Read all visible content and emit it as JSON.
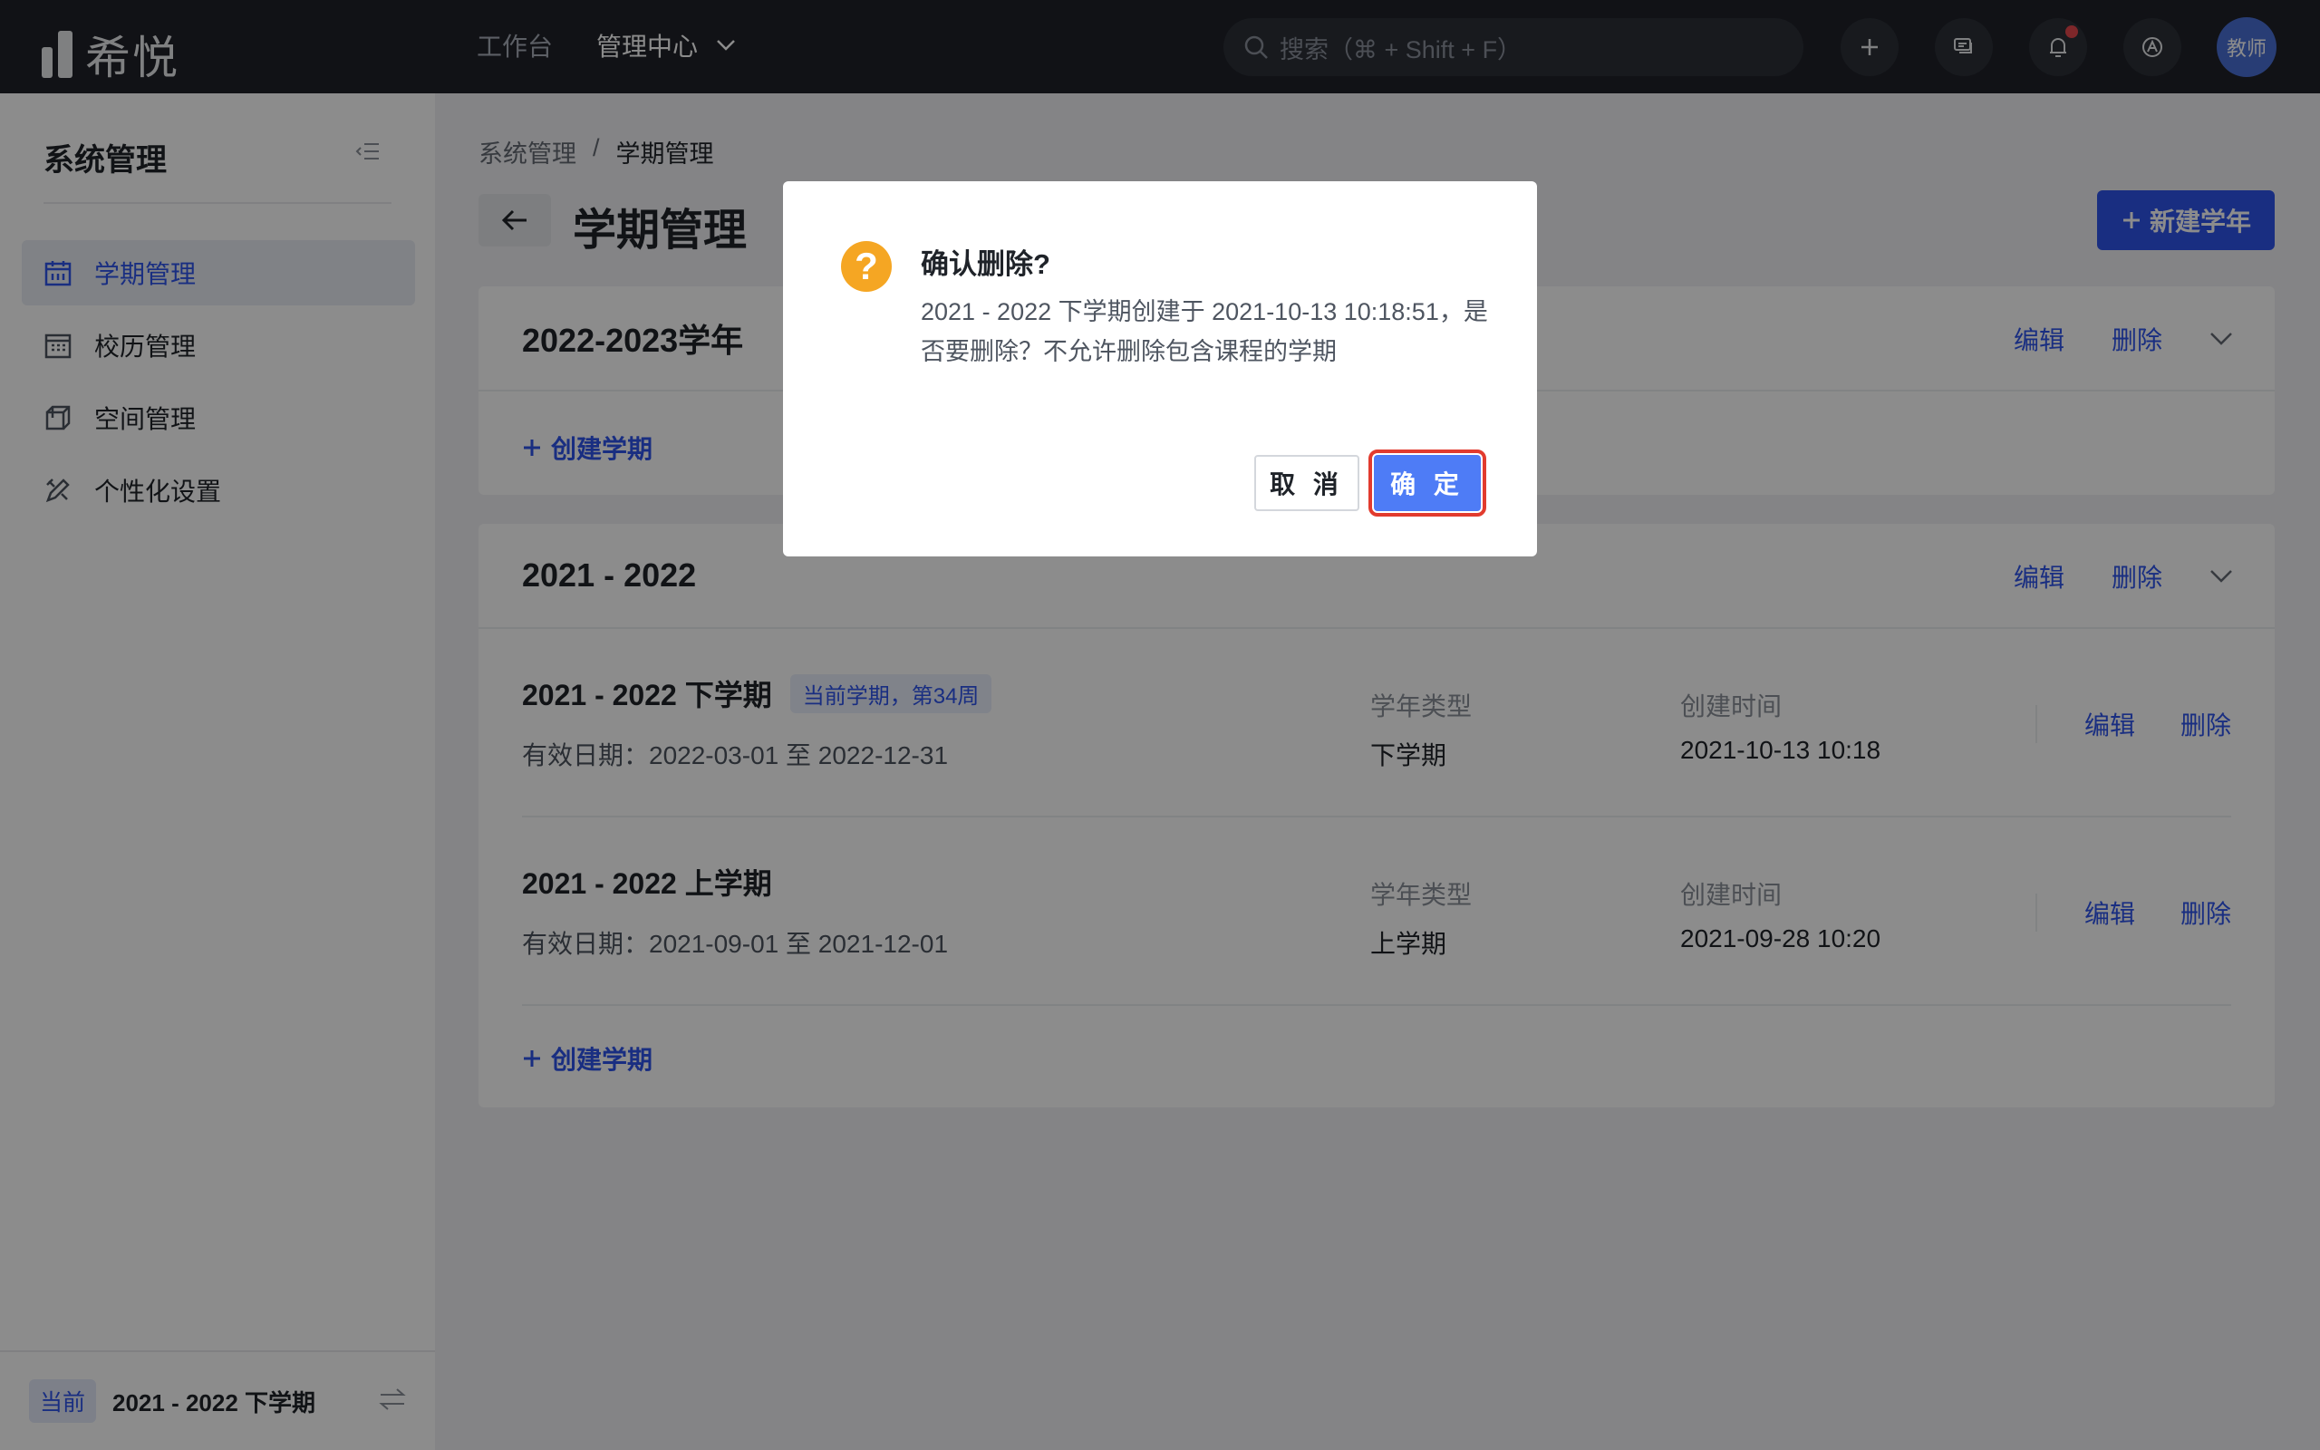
{
  "topbar": {
    "logo_text": "希悦",
    "nav": {
      "workbench": "工作台",
      "admin_center": "管理中心"
    },
    "search_placeholder": "搜索（⌘ + Shift + F）",
    "avatar_text": "教师"
  },
  "sidebar": {
    "title": "系统管理",
    "items": [
      {
        "label": "学期管理",
        "icon": "calendar-icon",
        "active": true
      },
      {
        "label": "校历管理",
        "icon": "calendar-grid-icon",
        "active": false
      },
      {
        "label": "空间管理",
        "icon": "cube-icon",
        "active": false
      },
      {
        "label": "个性化设置",
        "icon": "pencil-ruler-icon",
        "active": false
      }
    ],
    "current_tag": "当前",
    "current_term": "2021 - 2022 下学期"
  },
  "breadcrumb": {
    "parent": "系统管理",
    "separator": "/",
    "current": "学期管理"
  },
  "page_title": "学期管理",
  "new_year_button": "新建学年",
  "common": {
    "edit": "编辑",
    "delete": "删除",
    "create_term": "创建学期",
    "type_label": "学年类型",
    "created_label": "创建时间"
  },
  "years": [
    {
      "title": "2022-2023学年",
      "terms": []
    },
    {
      "title": "2021 - 2022",
      "terms": [
        {
          "name": "2021 - 2022 下学期",
          "badge": "当前学期，第34周",
          "date": "有效日期：2022-03-01 至 2022-12-31",
          "type": "下学期",
          "created": "2021-10-13 10:18"
        },
        {
          "name": "2021 - 2022 上学期",
          "badge": "",
          "date": "有效日期：2021-09-01 至 2021-12-01",
          "type": "上学期",
          "created": "2021-09-28 10:20"
        }
      ]
    }
  ],
  "modal": {
    "title": "确认删除?",
    "body": "2021 - 2022 下学期创建于 2021-10-13 10:18:51，是否要删除？不允许删除包含课程的学期",
    "cancel": "取 消",
    "confirm": "确 定"
  },
  "colors": {
    "primary": "#2f54eb",
    "warning": "#f5a623",
    "highlight_border": "#e23b2e"
  }
}
